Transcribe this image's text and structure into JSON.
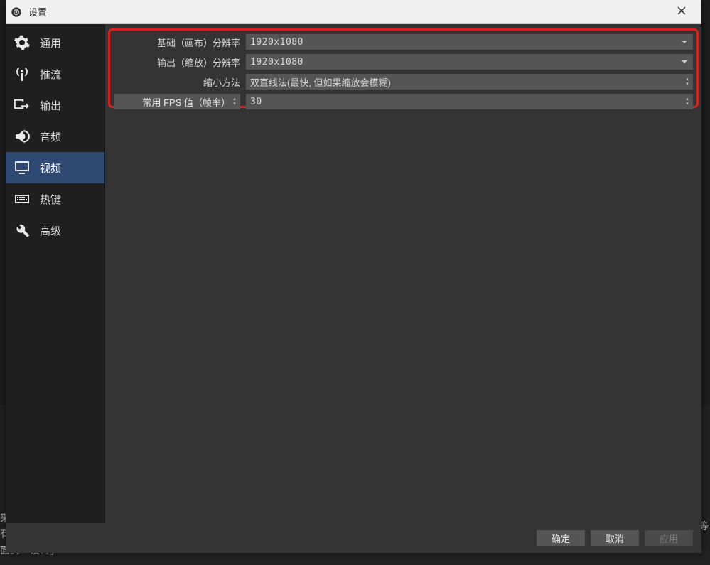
{
  "window": {
    "title": "设置"
  },
  "sidebar": {
    "items": [
      {
        "label": "通用"
      },
      {
        "label": "推流"
      },
      {
        "label": "输出"
      },
      {
        "label": "音频"
      },
      {
        "label": "视频"
      },
      {
        "label": "热键"
      },
      {
        "label": "高级"
      }
    ]
  },
  "form": {
    "base_res_label": "基础（画布）分辨率",
    "base_res_value": "1920x1080",
    "output_res_label": "输出（缩放）分辨率",
    "output_res_value": "1920x1080",
    "downscale_filter_label": "缩小方法",
    "downscale_filter_value": "双直线法(最快, 但如果缩放会模糊)",
    "fps_type_label": "常用 FPS 值（帧率）",
    "fps_value": "30"
  },
  "footer": {
    "ok": "确定",
    "cancel": "取消",
    "apply": "应用"
  },
  "backdrop": {
    "left1": "采",
    "left2": "有",
    "left3": "面的「设置」",
    "right": "等"
  }
}
